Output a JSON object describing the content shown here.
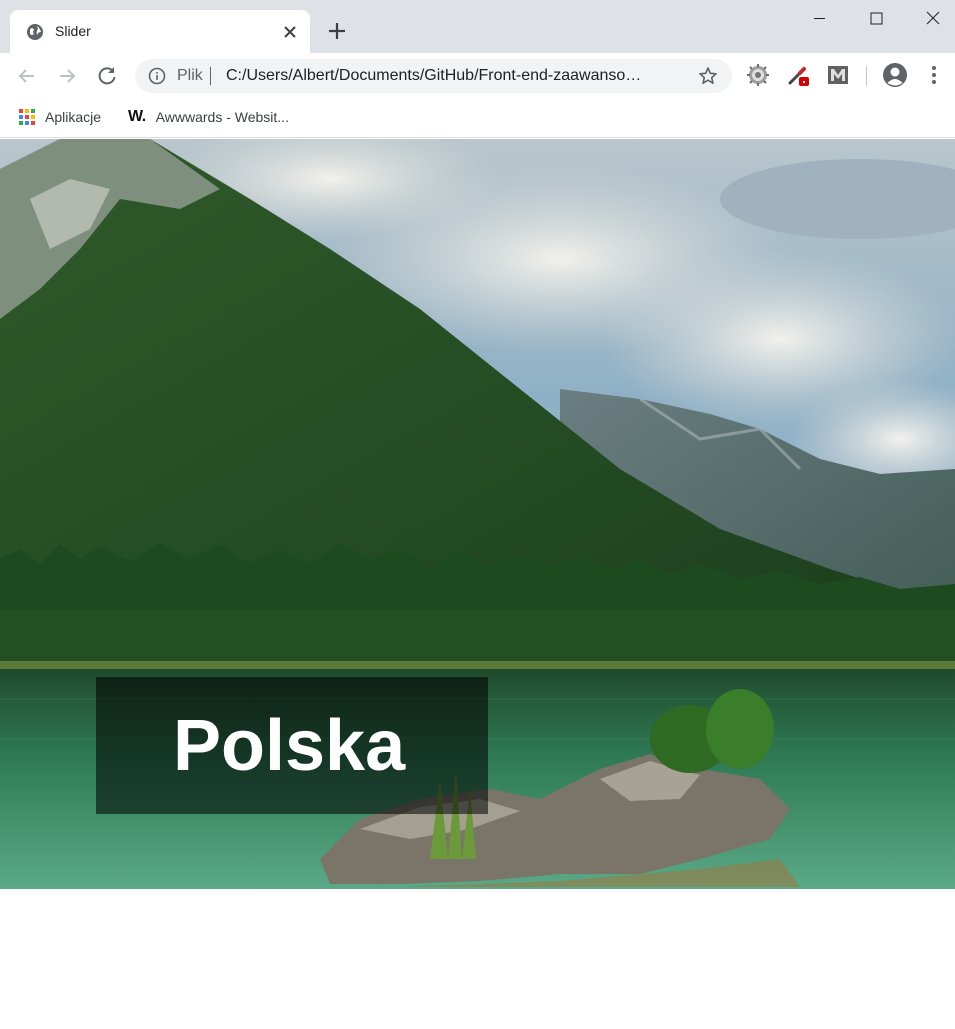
{
  "window": {
    "tab_title": "Slider",
    "favicon": "globe-icon"
  },
  "toolbar": {
    "scheme_label": "Plik",
    "url": "C:/Users/Albert/Documents/GitHub/Front-end-zaawanso…",
    "extensions": [
      "gear-extension-icon",
      "eyedropper-extension-icon",
      "m-extension-icon"
    ]
  },
  "bookmarks": {
    "items": [
      {
        "label": "Aplikacje",
        "icon": "apps-grid-icon"
      },
      {
        "label": "Awwwards - Websit...",
        "icon": "w-logo-icon",
        "logo_text": "W."
      }
    ]
  },
  "slider": {
    "caption": "Polska",
    "image": "mountain-lake-landscape"
  },
  "colors": {
    "tabstrip_bg": "#dee1e6",
    "omnibox_bg": "#f1f3f4",
    "caption_bg": "rgba(0,0,0,0.55)",
    "caption_text": "#ffffff"
  }
}
